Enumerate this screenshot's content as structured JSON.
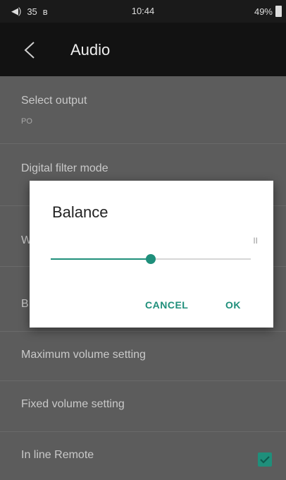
{
  "status_bar": {
    "left_text": "35",
    "time": "10:44",
    "battery": "49%",
    "icons": [
      "volume-icon",
      "bluetooth-icon",
      "battery-icon"
    ]
  },
  "app_bar": {
    "title": "Audio"
  },
  "settings": {
    "select_output": {
      "title": "Select output",
      "subtitle": "PO"
    },
    "digital_filter": {
      "title": "Digital filter mode",
      "subtitle": ""
    },
    "row3": {
      "title": "W",
      "subtitle": ""
    },
    "row4": {
      "title": "B",
      "subtitle": ""
    },
    "maximum_volume": {
      "title": "Maximum volume setting"
    },
    "fixed_volume": {
      "title": "Fixed volume setting"
    },
    "in_line_remote": {
      "title": "In line Remote",
      "checked": true
    }
  },
  "dialog": {
    "title": "Balance",
    "value": "II",
    "slider_fraction": 0.5,
    "cancel_label": "CANCEL",
    "ok_label": "OK"
  },
  "colors": {
    "accent": "#1f8f7b",
    "background": "#5c5c5c",
    "app_bar": "#121212"
  }
}
